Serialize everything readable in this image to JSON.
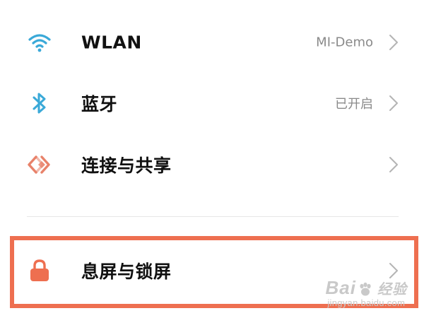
{
  "settings": {
    "rows": [
      {
        "label": "WLAN",
        "value": "MI-Demo",
        "icon": "wifi-icon",
        "icon_color": "#3aa9d8"
      },
      {
        "label": "蓝牙",
        "value": "已开启",
        "icon": "bluetooth-icon",
        "icon_color": "#3aa9d8"
      },
      {
        "label": "连接与共享",
        "value": "",
        "icon": "connection-sharing-icon",
        "icon_color": "#e8826a"
      },
      {
        "label": "息屏与锁屏",
        "value": "",
        "icon": "lock-icon",
        "icon_color": "#ee6f50"
      }
    ]
  },
  "highlight_color": "#ee6f50",
  "watermark": {
    "brand": "Bai",
    "brand_suffix": "经验",
    "url": "jingyan.baidu.com"
  }
}
